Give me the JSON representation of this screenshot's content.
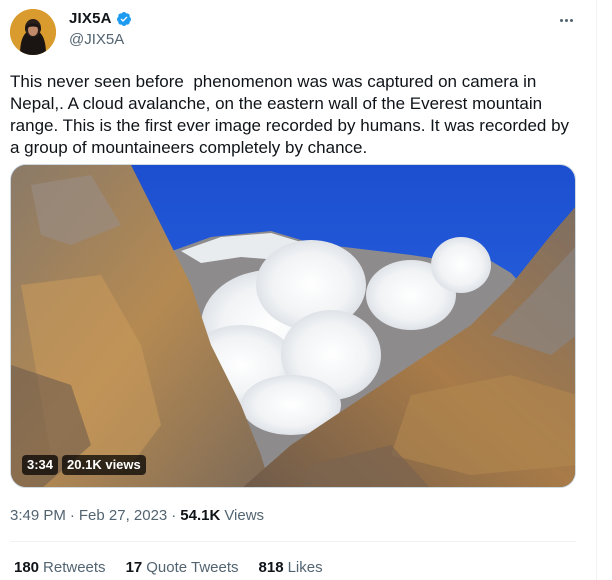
{
  "colors": {
    "text": "#0f1419",
    "secondary": "#536471",
    "verified": "#1d9bf0",
    "divider": "#eff3f4"
  },
  "author": {
    "display_name": "JIX5A",
    "handle": "@JIX5A",
    "verified": true
  },
  "tweet": {
    "text": "This never seen before  phenomenon was was captured on camera in Nepal,. A cloud avalanche, on the eastern wall of the Everest mountain range. This is the first ever image recorded by humans. It was recorded by a group of mountaineers completely by chance."
  },
  "video": {
    "duration": "3:34",
    "views": "20.1K views"
  },
  "meta": {
    "time": "3:49 PM",
    "separator1": "·",
    "date": "Feb 27, 2023",
    "separator2": "·",
    "views_count": "54.1K",
    "views_label": "Views"
  },
  "stats": [
    {
      "count": "180",
      "label": "Retweets"
    },
    {
      "count": "17",
      "label": "Quote Tweets"
    },
    {
      "count": "818",
      "label": "Likes"
    }
  ],
  "icons": {
    "more": "more-icon",
    "verified": "verified-badge-icon"
  }
}
